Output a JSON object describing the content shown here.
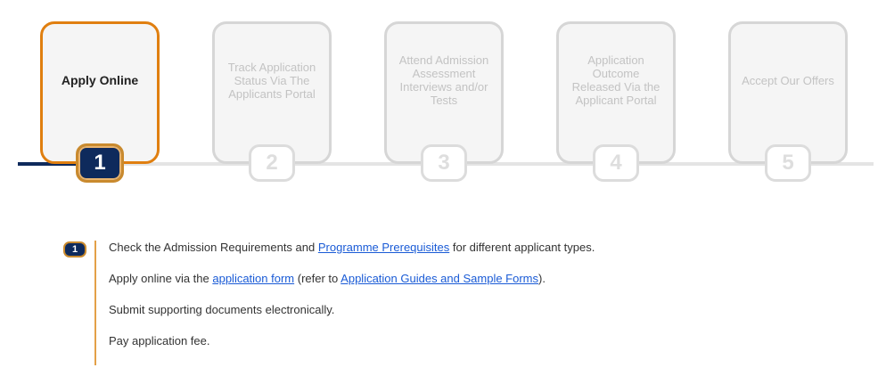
{
  "steps": [
    {
      "number": "1",
      "label": "Apply Online",
      "active": true
    },
    {
      "number": "2",
      "label": "Track Application Status Via The Applicants Portal",
      "active": false
    },
    {
      "number": "3",
      "label": "Attend Admission Assessment Interviews and/or Tests",
      "active": false
    },
    {
      "number": "4",
      "label": "Application Outcome Released Via the Applicant Portal",
      "active": false
    },
    {
      "number": "5",
      "label": "Accept Our Offers",
      "active": false
    }
  ],
  "detail": {
    "badge": "1",
    "line1": {
      "pre": "Check the Admission Requirements and ",
      "link": "Programme Prerequisites",
      "post": " for different applicant types."
    },
    "line2": {
      "pre": "Apply online via the ",
      "link1": "application form",
      "mid": " (refer to ",
      "link2": "Application Guides and Sample Forms",
      "post": ")."
    },
    "line3": "Submit supporting documents electronically.",
    "line4": "Pay application fee."
  },
  "colors": {
    "accent": "#e07f10",
    "navy": "#0e2a5c",
    "link": "#1a5bd6",
    "inactive": "#d6d6d6"
  }
}
